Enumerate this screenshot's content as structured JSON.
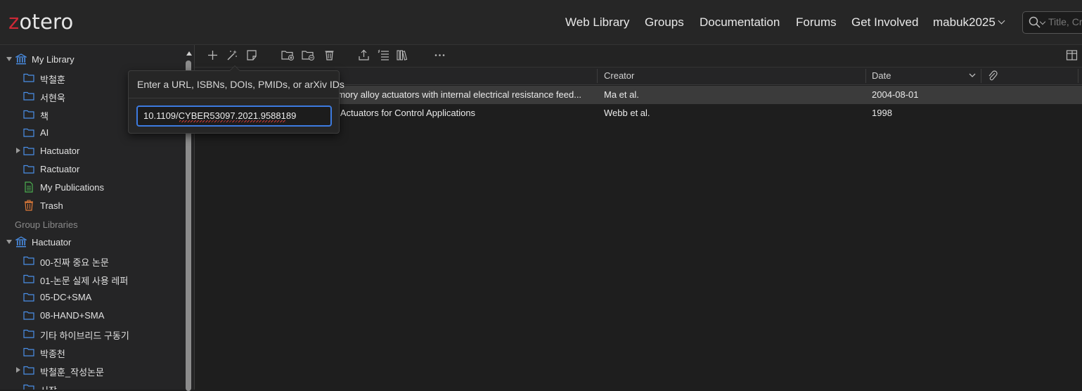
{
  "header": {
    "logo_first": "z",
    "logo_rest": "otero",
    "nav": [
      "Web Library",
      "Groups",
      "Documentation",
      "Forums",
      "Get Involved"
    ],
    "user": "mabuk2025",
    "search_placeholder": "Title, Creator"
  },
  "sidebar": {
    "my_library": "My Library",
    "my_items": [
      "박철훈",
      "서현욱",
      "책",
      "AI",
      "Hactuator",
      "Ractuator"
    ],
    "my_publications": "My Publications",
    "trash": "Trash",
    "group_header": "Group Libraries",
    "group_name": "Hactuator",
    "group_items": [
      "00-진짜 중요 논문",
      "01-논문 실제 사용 레퍼",
      "05-DC+SMA",
      "08-HAND+SMA",
      "기타 하이브리드 구동기",
      "박종천",
      "박철훈_작성논문",
      "시작"
    ]
  },
  "columns": {
    "creator": "Creator",
    "date": "Date"
  },
  "items": [
    {
      "title": "emory alloy actuators with internal electrical resistance feed...",
      "creator": "Ma et al.",
      "date": "2004-08-01"
    },
    {
      "title": "A Actuators for Control Applications",
      "creator": "Webb et al.",
      "date": "1998"
    }
  ],
  "popup": {
    "title": "Enter a URL, ISBNs, DOIs, PMIDs, or arXiv IDs",
    "value": "10.1109/CYBER53097.2021.9588189"
  },
  "icons": {
    "folder": "folder-icon",
    "library": "library-icon",
    "publications": "publications-icon",
    "trash": "trash-icon"
  },
  "colors": {
    "accent": "#3d7be0",
    "folder": "#4a8fe7",
    "publications": "#4caf50",
    "trash": "#e07b39",
    "logo_z": "#cc2936"
  }
}
